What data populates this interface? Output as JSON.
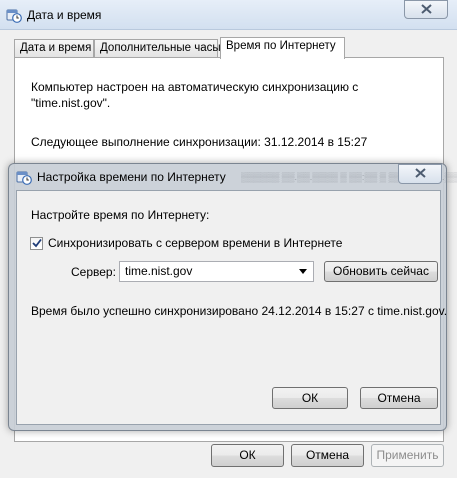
{
  "outer_window": {
    "title": "Дата и время",
    "tabs": [
      {
        "label": "Дата и время",
        "active": false
      },
      {
        "label": "Дополнительные часы",
        "active": false
      },
      {
        "label": "Время по Интернету",
        "active": true
      }
    ],
    "panel": {
      "sync_info": "Компьютер настроен на автоматическую синхронизацию с \"time.nist.gov\".",
      "next_sync": "Следующее выполнение синхронизации: 31.12.2014 в 15:27"
    },
    "buttons": {
      "ok": "ОК",
      "cancel": "Отмена",
      "apply": "Применить"
    }
  },
  "dialog": {
    "title": "Настройка времени по Интернету",
    "heading": "Настройте время по Интернету:",
    "sync_checkbox": {
      "label": "Синхронизировать с сервером времени в Интернете",
      "checked": true
    },
    "server_label": "Сервер:",
    "server_value": "time.nist.gov",
    "update_now": "Обновить сейчас",
    "status": "Время было успешно синхронизировано 24.12.2014 в 15:27 с time.nist.gov.",
    "buttons": {
      "ok": "ОК",
      "cancel": "Отмена"
    }
  },
  "icons": {
    "app": "date-time-icon",
    "close": "close-icon",
    "combo_arrow": "chevron-down-icon",
    "check": "checkmark-icon"
  },
  "colors": {
    "titlebar": "#d3e0f0",
    "window_bg": "#f0f0f0",
    "dialog_frame": "#c8ced6"
  }
}
